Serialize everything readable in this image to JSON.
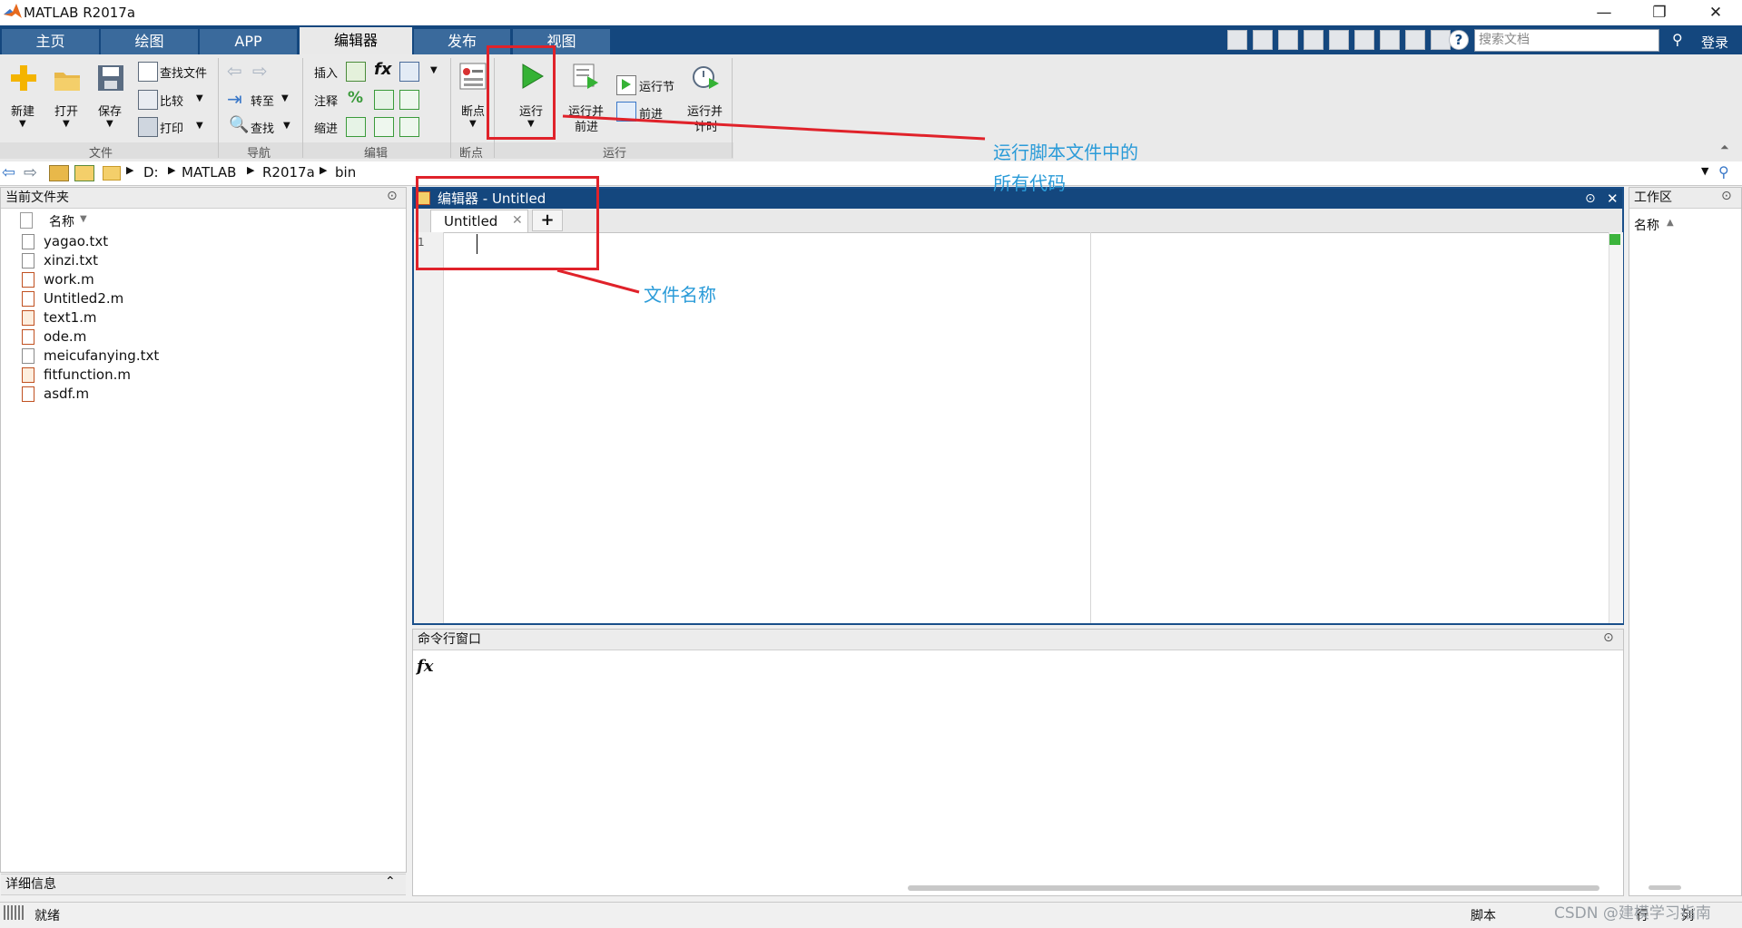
{
  "window": {
    "title": "MATLAB R2017a",
    "minimize": "—",
    "restore": "❐",
    "close": "✕"
  },
  "tabs": [
    "主页",
    "绘图",
    "APP",
    "编辑器",
    "发布",
    "视图"
  ],
  "search": {
    "placeholder": "搜索文档"
  },
  "login_label": "登录",
  "ribbon": {
    "file": {
      "new": "新建",
      "open": "打开",
      "save": "保存",
      "find_files": "查找文件",
      "compare": "比较",
      "print": "打印",
      "group": "文件"
    },
    "navigate": {
      "goto": "转至",
      "find": "查找",
      "group": "导航"
    },
    "edit": {
      "insert": "插入",
      "comment": "注释",
      "indent": "缩进",
      "fx": "fx",
      "percent": "%",
      "group": "编辑"
    },
    "breakpoints": {
      "label": "断点",
      "group": "断点"
    },
    "run": {
      "run": "运行",
      "run_advance_1": "运行并",
      "run_advance_2": "前进",
      "run_section": "运行节",
      "advance": "前进",
      "run_time_1": "运行并",
      "run_time_2": "计时",
      "group": "运行"
    }
  },
  "address": {
    "parts": [
      "D:",
      "MATLAB",
      "R2017a",
      "bin"
    ]
  },
  "current_folder": {
    "title": "当前文件夹",
    "column": "名称",
    "files": [
      "yagao.txt",
      "xinzi.txt",
      "work.m",
      "Untitled2.m",
      "text1.m",
      "ode.m",
      "meicufanying.txt",
      "fitfunction.m",
      "asdf.m"
    ],
    "details": "详细信息"
  },
  "editor": {
    "title": "编辑器 - Untitled",
    "tab": "Untitled",
    "line_no": "1"
  },
  "command_window": {
    "title": "命令行窗口",
    "prompt": "fx"
  },
  "workspace": {
    "title": "工作区",
    "column": "名称"
  },
  "status": {
    "ready": "就绪",
    "script": "脚本",
    "row": "行",
    "col": "列"
  },
  "annotations": {
    "run_1": "运行脚本文件中的",
    "run_2": "所有代码",
    "file_name": "文件名称"
  },
  "watermark": "CSDN @建模学习指南",
  "colors": {
    "tab_strip": "#14477e",
    "annotation": "#2a9bd8",
    "highlight": "#e0222a"
  }
}
